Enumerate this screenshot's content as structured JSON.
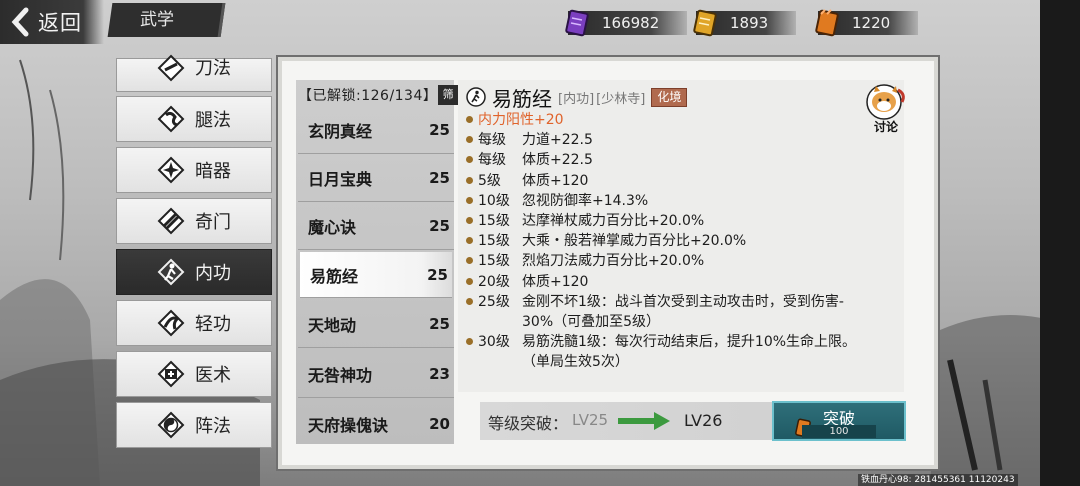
{
  "header": {
    "back_label": "返回",
    "title": "武学"
  },
  "resources": [
    {
      "icon": "purple-scroll-icon",
      "value": "166982",
      "color": "#7b3fc0"
    },
    {
      "icon": "gold-scroll-icon",
      "value": "1893",
      "color": "#e0a528"
    },
    {
      "icon": "orange-scroll-icon",
      "value": "1220",
      "color": "#e07a20"
    }
  ],
  "sidebar": {
    "items": [
      {
        "label": "刀法",
        "icon": "blade-icon"
      },
      {
        "label": "腿法",
        "icon": "kick-icon"
      },
      {
        "label": "暗器",
        "icon": "shuriken-icon"
      },
      {
        "label": "奇门",
        "icon": "scroll-weapon-icon"
      },
      {
        "label": "内功",
        "icon": "inner-power-icon",
        "active": true
      },
      {
        "label": "轻功",
        "icon": "lightness-icon"
      },
      {
        "label": "医术",
        "icon": "medicine-icon"
      },
      {
        "label": "阵法",
        "icon": "taiji-icon"
      }
    ]
  },
  "skill_list": {
    "unlock_label": "【已解锁:126/134】",
    "filter_label": "筛",
    "items": [
      {
        "name": "玄阴真经",
        "level": "25"
      },
      {
        "name": "日月宝典",
        "level": "25"
      },
      {
        "name": "魔心诀",
        "level": "25"
      },
      {
        "name": "易筋经",
        "level": "25",
        "selected": true
      },
      {
        "name": "天地动",
        "level": "25"
      },
      {
        "name": "无咎神功",
        "level": "23"
      },
      {
        "name": "天府操傀诀",
        "level": "20"
      }
    ]
  },
  "detail": {
    "name": "易筋经",
    "type_tag": "[内功]",
    "school_tag": "[少林寺]",
    "realm": "化境",
    "discuss_label": "讨论",
    "lines": [
      {
        "text": "内力阳性+20",
        "highlight": true
      },
      {
        "level": "每级",
        "text": "力道+22.5"
      },
      {
        "level": "每级",
        "text": "体质+22.5"
      },
      {
        "level": "5级",
        "text": "体质+120"
      },
      {
        "level": "10级",
        "text": "忽视防御率+14.3%"
      },
      {
        "level": "15级",
        "text": "达摩禅杖威力百分比+20.0%"
      },
      {
        "level": "15级",
        "text": "大乘・般若禅掌威力百分比+20.0%"
      },
      {
        "level": "15级",
        "text": "烈焰刀法威力百分比+20.0%"
      },
      {
        "level": "20级",
        "text": "体质+120"
      },
      {
        "level": "25级",
        "text": "金刚不坏1级：战斗首次受到主动攻击时，受到伤害-",
        "cont": "30%（可叠加至5级）"
      },
      {
        "level": "30级",
        "text": "易筋洗髓1级：每次行动结束后，提升10%生命上限。",
        "cont": "（单局生效5次）"
      }
    ]
  },
  "breakthrough": {
    "label": "等级突破：",
    "from": "LV25",
    "to": "LV26",
    "button_label": "突破",
    "cost": "100"
  },
  "footer": "铁血丹心98: 281455361  11120243"
}
